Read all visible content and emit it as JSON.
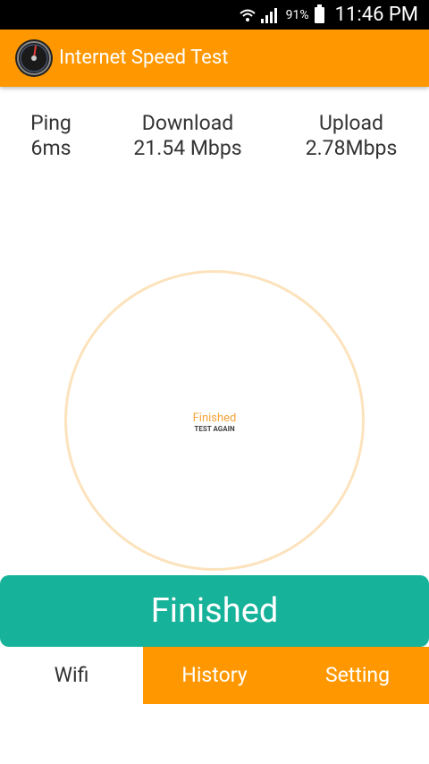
{
  "status_bar": {
    "battery": "91%",
    "time": "11:46 PM",
    "icons": [
      "wifi-icon",
      "signal-icon",
      "battery-icon"
    ]
  },
  "app_bar": {
    "title": "Internet Speed Test",
    "icon": "speedometer-icon",
    "color": "#ff9800"
  },
  "stats": {
    "ping": {
      "label": "Ping",
      "value": "6ms"
    },
    "download": {
      "label": "Download",
      "value": "21.54 Mbps"
    },
    "upload": {
      "label": "Upload",
      "value": "2.78Mbps"
    }
  },
  "gauge": {
    "status": "Finished",
    "action": "TEST AGAIN"
  },
  "finish_button": {
    "label": "Finished",
    "color": "#17b29a"
  },
  "tabs": [
    {
      "label": "Wifi",
      "active": true
    },
    {
      "label": "History",
      "active": false
    },
    {
      "label": "Setting",
      "active": false
    }
  ]
}
